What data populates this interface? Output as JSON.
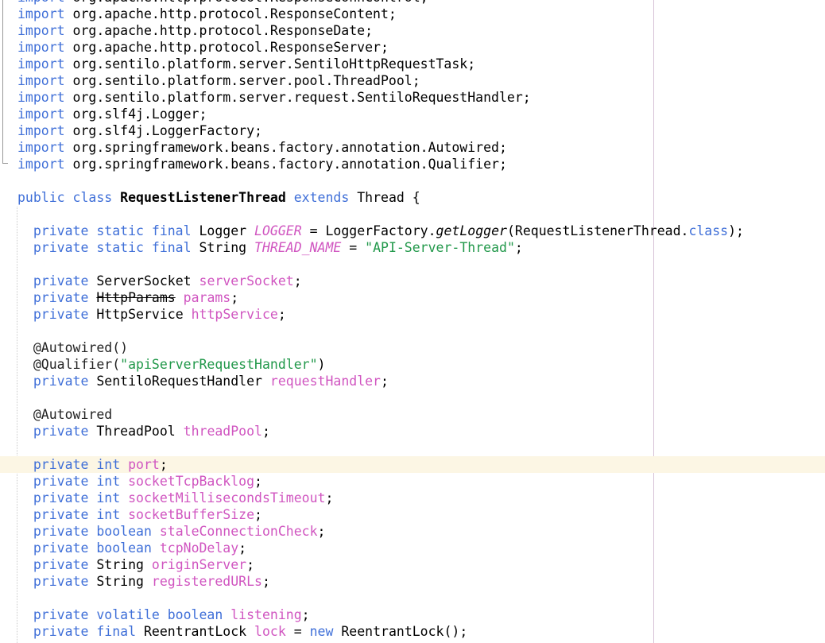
{
  "colors": {
    "keyword": "#3f6fd8",
    "field": "#d055c0",
    "string": "#21984a",
    "current_line": "#fcf6e4"
  },
  "highlighted_line": 28,
  "lines": [
    [
      [
        "kw",
        "import"
      ],
      [
        "",
        "org.apache.http.protocol.ResponseConnControl;"
      ]
    ],
    [
      [
        "kw",
        "import"
      ],
      [
        "",
        "org.apache.http.protocol.ResponseContent;"
      ]
    ],
    [
      [
        "kw",
        "import"
      ],
      [
        "",
        "org.apache.http.protocol.ResponseDate;"
      ]
    ],
    [
      [
        "kw",
        "import"
      ],
      [
        "",
        "org.apache.http.protocol.ResponseServer;"
      ]
    ],
    [
      [
        "kw",
        "import"
      ],
      [
        "",
        "org.sentilo.platform.server.SentiloHttpRequestTask;"
      ]
    ],
    [
      [
        "kw",
        "import"
      ],
      [
        "",
        "org.sentilo.platform.server.pool.ThreadPool;"
      ]
    ],
    [
      [
        "kw",
        "import"
      ],
      [
        "",
        "org.sentilo.platform.server.request.SentiloRequestHandler;"
      ]
    ],
    [
      [
        "kw",
        "import"
      ],
      [
        "",
        "org.slf4j.Logger;"
      ]
    ],
    [
      [
        "kw",
        "import"
      ],
      [
        "",
        "org.slf4j.LoggerFactory;"
      ]
    ],
    [
      [
        "kw",
        "import"
      ],
      [
        "",
        "org.springframework.beans.factory.annotation.Autowired;"
      ]
    ],
    [
      [
        "kw",
        "import"
      ],
      [
        "",
        "org.springframework.beans.factory.annotation.Qualifier;"
      ]
    ],
    [],
    [
      [
        "kw",
        "public class"
      ],
      [
        "bold",
        "RequestListenerThread"
      ],
      [
        "kw",
        "extends"
      ],
      [
        "",
        "Thread {"
      ]
    ],
    [],
    [
      [
        "",
        "  "
      ],
      [
        "kw",
        "private static final"
      ],
      [
        "",
        "Logger"
      ],
      [
        "fld ital",
        "LOGGER"
      ],
      [
        "",
        "= LoggerFactory."
      ],
      [
        "ital",
        "getLogger"
      ],
      [
        "",
        "(RequestListenerThread."
      ],
      [
        "kw",
        "class"
      ],
      [
        "",
        ");"
      ]
    ],
    [
      [
        "",
        "  "
      ],
      [
        "kw",
        "private static final"
      ],
      [
        "",
        "String"
      ],
      [
        "fld ital",
        "THREAD_NAME"
      ],
      [
        "",
        "="
      ],
      [
        "str",
        "\"API-Server-Thread\""
      ],
      [
        "",
        ";"
      ]
    ],
    [],
    [
      [
        "",
        "  "
      ],
      [
        "kw",
        "private"
      ],
      [
        "",
        "ServerSocket"
      ],
      [
        "fld",
        "serverSocket"
      ],
      [
        "",
        ";"
      ]
    ],
    [
      [
        "",
        "  "
      ],
      [
        "kw",
        "private"
      ],
      [
        "strike",
        "HttpParams"
      ],
      [
        "fld",
        "params"
      ],
      [
        "",
        ";"
      ]
    ],
    [
      [
        "",
        "  "
      ],
      [
        "kw",
        "private"
      ],
      [
        "",
        "HttpService"
      ],
      [
        "fld",
        "httpService"
      ],
      [
        "",
        ";"
      ]
    ],
    [],
    [
      [
        "",
        "  "
      ],
      [
        "ann",
        "@Autowired()"
      ]
    ],
    [
      [
        "",
        "  "
      ],
      [
        "ann",
        "@Qualifier("
      ],
      [
        "str",
        "\"apiServerRequestHandler\""
      ],
      [
        "",
        ")"
      ]
    ],
    [
      [
        "",
        "  "
      ],
      [
        "kw",
        "private"
      ],
      [
        "",
        "SentiloRequestHandler"
      ],
      [
        "fld",
        "requestHandler"
      ],
      [
        "",
        ";"
      ]
    ],
    [],
    [
      [
        "",
        "  "
      ],
      [
        "ann",
        "@Autowired"
      ]
    ],
    [
      [
        "",
        "  "
      ],
      [
        "kw",
        "private"
      ],
      [
        "",
        "ThreadPool"
      ],
      [
        "fld",
        "threadPool"
      ],
      [
        "",
        ";"
      ]
    ],
    [],
    [
      [
        "",
        "  "
      ],
      [
        "kw",
        "private int"
      ],
      [
        "fld",
        "port"
      ],
      [
        "",
        ";"
      ]
    ],
    [
      [
        "",
        "  "
      ],
      [
        "kw",
        "private int"
      ],
      [
        "fld",
        "socketTcpBacklog"
      ],
      [
        "",
        ";"
      ]
    ],
    [
      [
        "",
        "  "
      ],
      [
        "kw",
        "private int"
      ],
      [
        "fld",
        "socketMillisecondsTimeout"
      ],
      [
        "",
        ";"
      ]
    ],
    [
      [
        "",
        "  "
      ],
      [
        "kw",
        "private int"
      ],
      [
        "fld",
        "socketBufferSize"
      ],
      [
        "",
        ";"
      ]
    ],
    [
      [
        "",
        "  "
      ],
      [
        "kw",
        "private boolean"
      ],
      [
        "fld",
        "staleConnectionCheck"
      ],
      [
        "",
        ";"
      ]
    ],
    [
      [
        "",
        "  "
      ],
      [
        "kw",
        "private boolean"
      ],
      [
        "fld",
        "tcpNoDelay"
      ],
      [
        "",
        ";"
      ]
    ],
    [
      [
        "",
        "  "
      ],
      [
        "kw",
        "private"
      ],
      [
        "",
        "String"
      ],
      [
        "fld",
        "originServer"
      ],
      [
        "",
        ";"
      ]
    ],
    [
      [
        "",
        "  "
      ],
      [
        "kw",
        "private"
      ],
      [
        "",
        "String"
      ],
      [
        "fld",
        "registeredURLs"
      ],
      [
        "",
        ";"
      ]
    ],
    [],
    [
      [
        "",
        "  "
      ],
      [
        "kw",
        "private volatile boolean"
      ],
      [
        "fld",
        "listening"
      ],
      [
        "",
        ";"
      ]
    ],
    [
      [
        "",
        "  "
      ],
      [
        "kw",
        "private final"
      ],
      [
        "",
        "ReentrantLock"
      ],
      [
        "fld",
        "lock"
      ],
      [
        "",
        "="
      ],
      [
        "kw",
        "new"
      ],
      [
        "",
        "ReentrantLock();"
      ]
    ]
  ]
}
